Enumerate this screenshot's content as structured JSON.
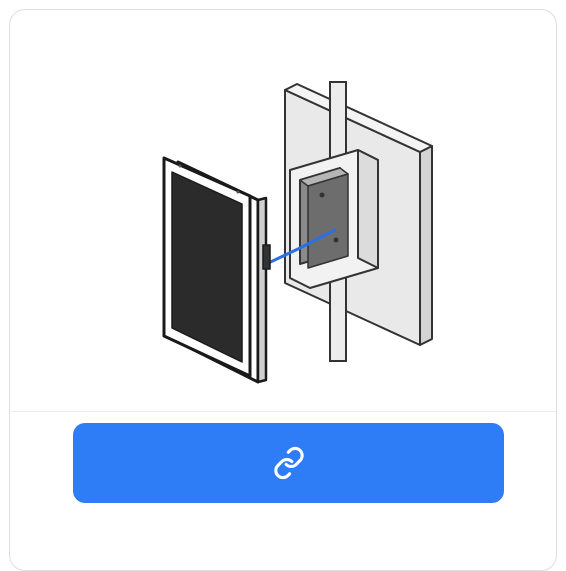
{
  "card": {
    "accent_color": "#2e7cf6",
    "illustration": "touch-panel-wall-box-connection",
    "action_button": {
      "icon": "link-icon",
      "label": ""
    }
  }
}
